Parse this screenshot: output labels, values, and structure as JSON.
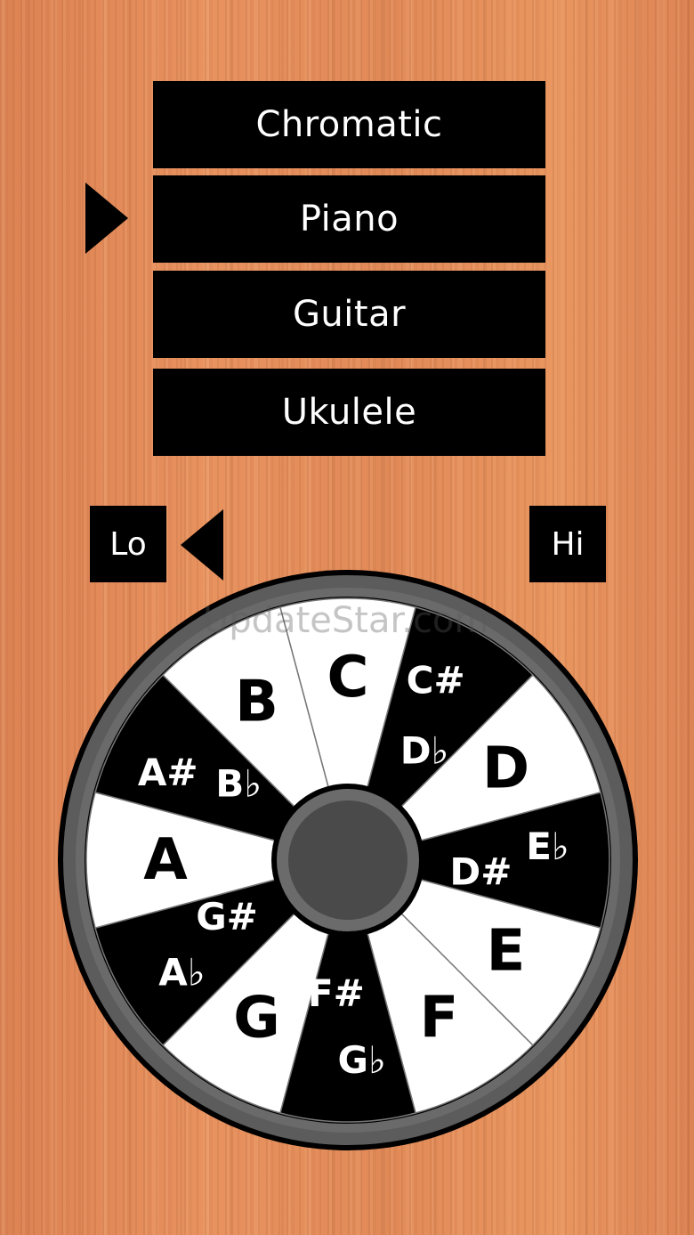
{
  "modes": [
    {
      "label": "Chromatic"
    },
    {
      "label": "Piano"
    },
    {
      "label": "Guitar"
    },
    {
      "label": "Ukulele"
    }
  ],
  "selected_mode": "Piano",
  "octave": {
    "lo_label": "Lo",
    "hi_label": "Hi",
    "selected": "Lo"
  },
  "watermark": "UpdateStar.com",
  "wheel": {
    "colors": {
      "white_key": "#ffffff",
      "black_key": "#000000",
      "rim": "#5a5a5a",
      "hub": "#4a4a4a"
    },
    "notes": [
      {
        "name": "C",
        "color": "white"
      },
      {
        "name": "C#",
        "alt": "D♭",
        "color": "black"
      },
      {
        "name": "D",
        "color": "white"
      },
      {
        "name": "E♭",
        "alt": "D#",
        "color": "black"
      },
      {
        "name": "E",
        "color": "white"
      },
      {
        "name": "F",
        "color": "white"
      },
      {
        "name": "G♭",
        "alt": "F#",
        "color": "black"
      },
      {
        "name": "G",
        "color": "white"
      },
      {
        "name": "A♭",
        "alt": "G#",
        "color": "black"
      },
      {
        "name": "A",
        "color": "white"
      },
      {
        "name": "A#",
        "alt": "B♭",
        "color": "black"
      },
      {
        "name": "B",
        "color": "white"
      }
    ]
  }
}
